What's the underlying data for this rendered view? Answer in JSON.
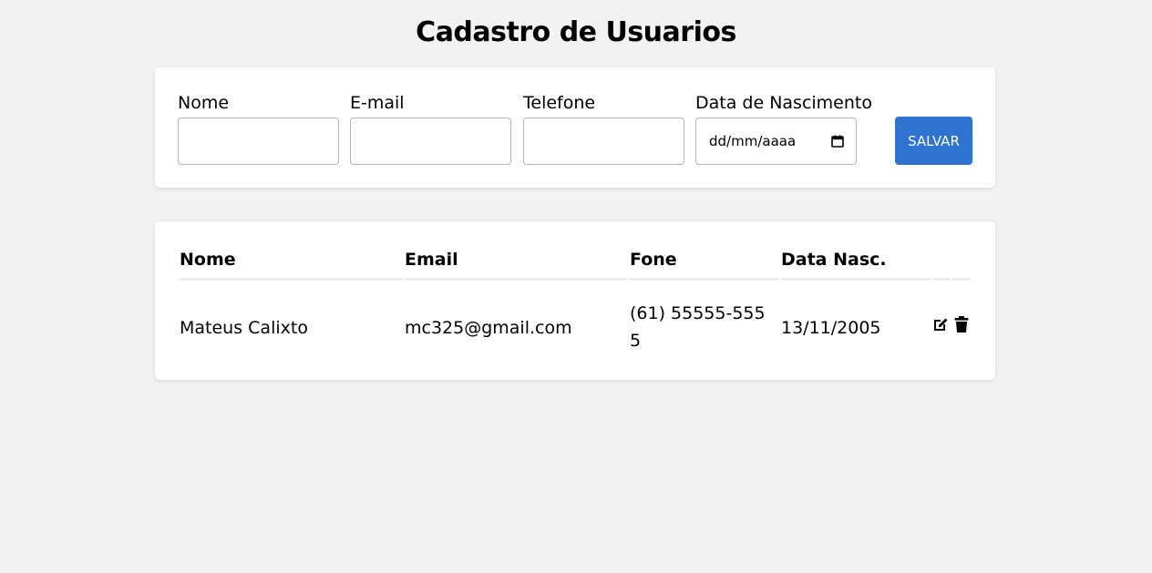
{
  "page": {
    "title": "Cadastro de Usuarios"
  },
  "form": {
    "fields": [
      {
        "label": "Nome",
        "value": "",
        "placeholder": ""
      },
      {
        "label": "E-mail",
        "value": "",
        "placeholder": ""
      },
      {
        "label": "Telefone",
        "value": "",
        "placeholder": ""
      },
      {
        "label": "Data de Nascimento",
        "value": "dd/mm/aaaa",
        "icon": "calendar-icon"
      }
    ],
    "save_label": "SALVAR",
    "save_color": "#2f73d0"
  },
  "table": {
    "headers": [
      "Nome",
      "Email",
      "Fone",
      "Data Nasc."
    ],
    "rows": [
      {
        "nome": "Mateus Calixto",
        "email": "mc325@gmail.com",
        "fone_line1": "(61) 55555-555",
        "fone_line2": "5",
        "nascimento": "13/11/2005",
        "actions": [
          "edit-icon",
          "trash-icon"
        ]
      }
    ]
  }
}
